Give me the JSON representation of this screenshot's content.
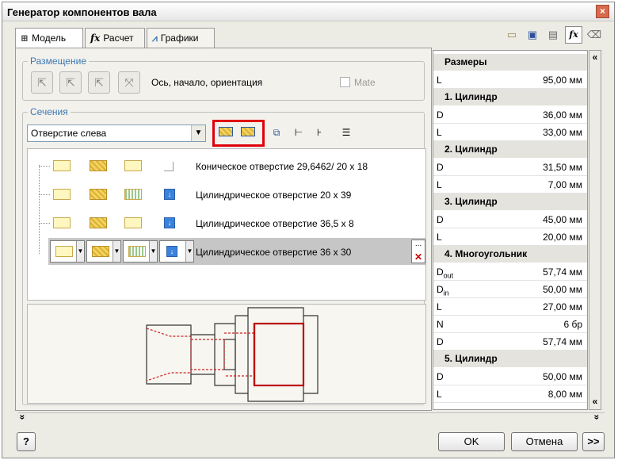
{
  "window": {
    "title": "Генератор компонентов вала",
    "close_glyph": "×"
  },
  "tabs": [
    {
      "label": "Модель",
      "icon": "model-icon"
    },
    {
      "label": "Расчет",
      "icon": "fx-calc-icon",
      "prefix": "fx"
    },
    {
      "label": "Графики",
      "icon": "chart-icon"
    }
  ],
  "toolbar_right": [
    "open-folder-icon",
    "save-icon",
    "settings-icon",
    "fx-icon",
    "eraser-icon"
  ],
  "placement": {
    "label": "Размещение",
    "orientation_text": "Ось, начало, ориентация",
    "mate_label": "Mate"
  },
  "sections": {
    "label": "Сечения",
    "selected": "Отверстие слева",
    "items": [
      {
        "name": "Коническое отверстие 29,6462/ 20 x 18"
      },
      {
        "name": "Цилиндрическое отверстие 20 x 39"
      },
      {
        "name": "Цилиндрическое отверстие 36,5 x 8"
      },
      {
        "name": "Цилиндрическое отверстие 36 x 30"
      }
    ],
    "more_glyph": "...",
    "delete_glyph": "✕"
  },
  "dimensions": {
    "header": "Размеры",
    "L_total": {
      "key": "L",
      "value": "95,00 мм"
    },
    "groups": [
      {
        "title": "1. Цилиндр",
        "rows": [
          {
            "key": "D",
            "value": "36,00 мм"
          },
          {
            "key": "L",
            "value": "33,00 мм"
          }
        ]
      },
      {
        "title": "2. Цилиндр",
        "rows": [
          {
            "key": "D",
            "value": "31,50 мм"
          },
          {
            "key": "L",
            "value": "7,00 мм"
          }
        ]
      },
      {
        "title": "3. Цилиндр",
        "rows": [
          {
            "key": "D",
            "value": "45,00 мм"
          },
          {
            "key": "L",
            "value": "20,00 мм"
          }
        ]
      },
      {
        "title": "4. Многоугольник",
        "rows": [
          {
            "key": "D",
            "sub": "out",
            "value": "57,74 мм"
          },
          {
            "key": "D",
            "sub": "in",
            "value": "50,00 мм"
          },
          {
            "key": "L",
            "value": "27,00 мм"
          },
          {
            "key": "N",
            "value": "6 бр"
          },
          {
            "key": "D",
            "value": "57,74 мм"
          }
        ]
      },
      {
        "title": "5. Цилиндр",
        "rows": [
          {
            "key": "D",
            "value": "50,00 мм"
          },
          {
            "key": "L",
            "value": "8,00 мм"
          }
        ]
      }
    ]
  },
  "buttons": {
    "help": "?",
    "ok": "OK",
    "cancel": "Отмена",
    "more": ">>"
  },
  "glyphs": {
    "collapse_up": "«",
    "collapse_down": "»",
    "expand": "»"
  },
  "colors": {
    "highlight": "#e0000b",
    "accent": "#3c78b4"
  }
}
